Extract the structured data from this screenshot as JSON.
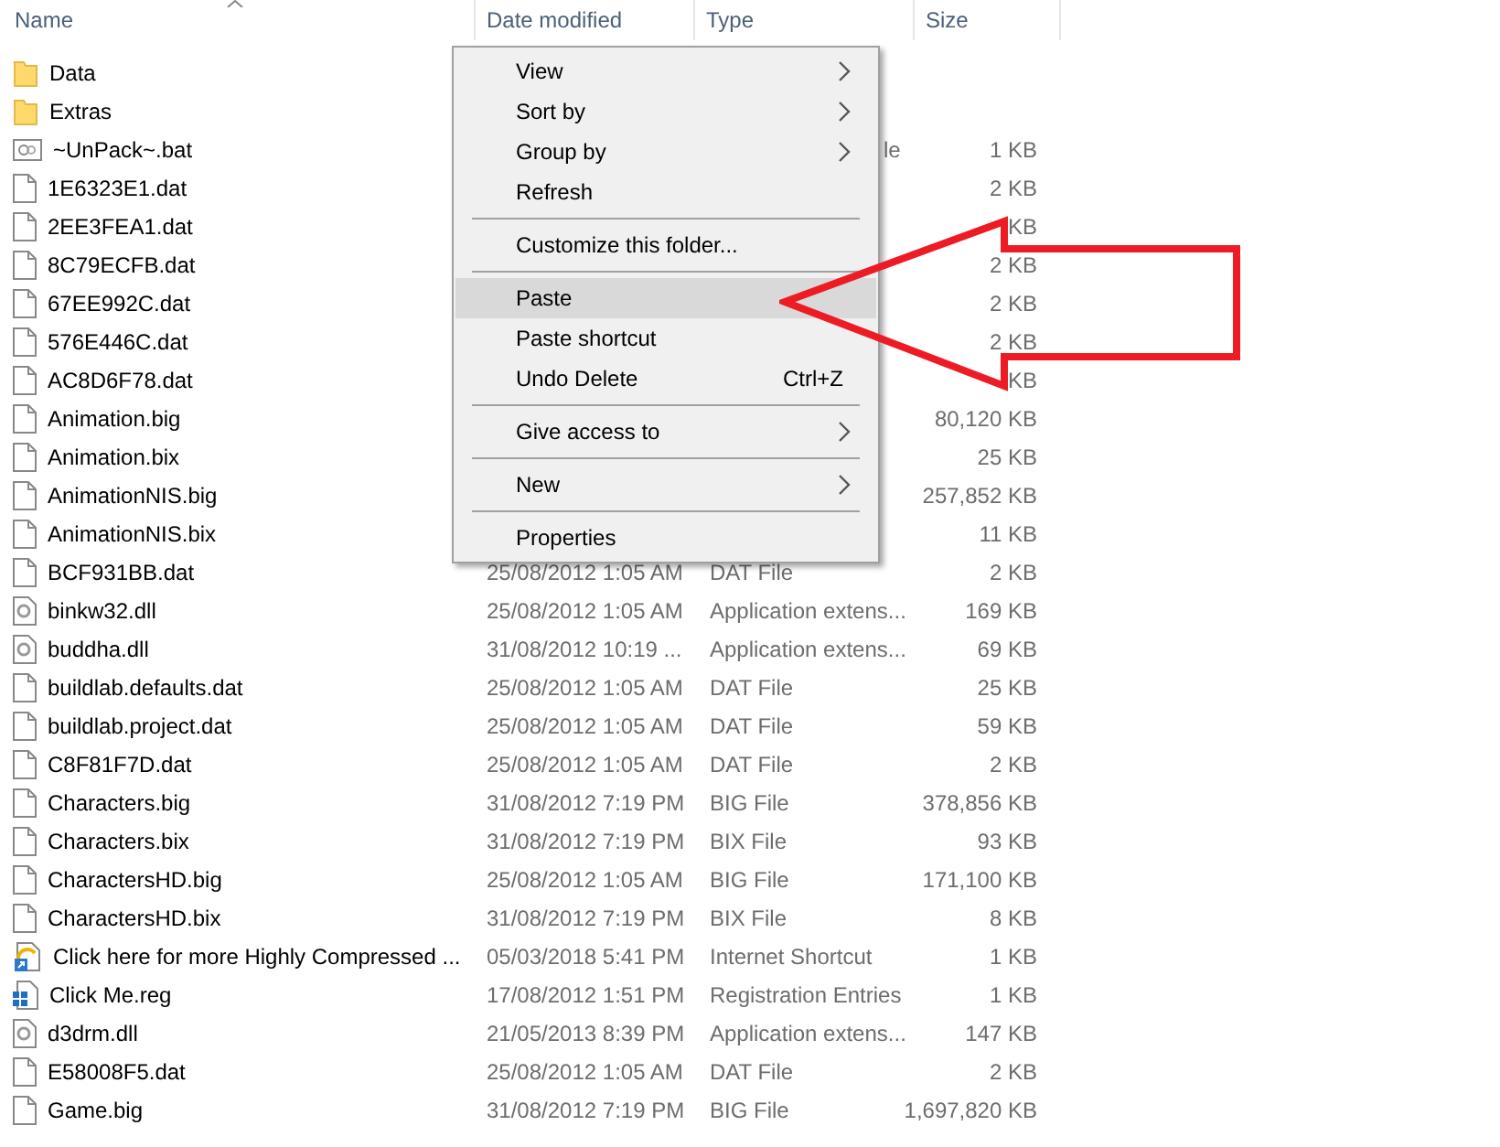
{
  "columns": [
    "Name",
    "Date modified",
    "Type",
    "Size"
  ],
  "rows": [
    {
      "kind": "folder",
      "name": "Data"
    },
    {
      "kind": "folder",
      "name": "Extras"
    },
    {
      "kind": "bat",
      "name": "~UnPack~.bat",
      "type": "le",
      "type_cut": true,
      "size": "1 KB"
    },
    {
      "kind": "file",
      "name": "1E6323E1.dat",
      "size": "2 KB"
    },
    {
      "kind": "file",
      "name": "2EE3FEA1.dat",
      "size": "KB"
    },
    {
      "kind": "file",
      "name": "8C79ECFB.dat",
      "size": "2 KB"
    },
    {
      "kind": "file",
      "name": "67EE992C.dat",
      "size": "2 KB"
    },
    {
      "kind": "file",
      "name": "576E446C.dat",
      "size": "2 KB"
    },
    {
      "kind": "file",
      "name": "AC8D6F78.dat",
      "size": "KB"
    },
    {
      "kind": "file",
      "name": "Animation.big",
      "size": "80,120 KB"
    },
    {
      "kind": "file",
      "name": "Animation.bix",
      "size": "25 KB"
    },
    {
      "kind": "file",
      "name": "AnimationNIS.big",
      "size": "257,852 KB"
    },
    {
      "kind": "file",
      "name": "AnimationNIS.bix",
      "size": "11 KB"
    },
    {
      "kind": "file",
      "name": "BCF931BB.dat",
      "date": "25/08/2012 1:05 AM",
      "type": "DAT File",
      "size": "2 KB"
    },
    {
      "kind": "dll",
      "name": "binkw32.dll",
      "date": "25/08/2012 1:05 AM",
      "type": "Application extens...",
      "size": "169 KB"
    },
    {
      "kind": "dll",
      "name": "buddha.dll",
      "date": "31/08/2012 10:19 ...",
      "type": "Application extens...",
      "size": "69 KB"
    },
    {
      "kind": "file",
      "name": "buildlab.defaults.dat",
      "date": "25/08/2012 1:05 AM",
      "type": "DAT File",
      "size": "25 KB"
    },
    {
      "kind": "file",
      "name": "buildlab.project.dat",
      "date": "25/08/2012 1:05 AM",
      "type": "DAT File",
      "size": "59 KB"
    },
    {
      "kind": "file",
      "name": "C8F81F7D.dat",
      "date": "25/08/2012 1:05 AM",
      "type": "DAT File",
      "size": "2 KB"
    },
    {
      "kind": "file",
      "name": "Characters.big",
      "date": "31/08/2012 7:19 PM",
      "type": "BIG File",
      "size": "378,856 KB"
    },
    {
      "kind": "file",
      "name": "Characters.bix",
      "date": "31/08/2012 7:19 PM",
      "type": "BIX File",
      "size": "93 KB"
    },
    {
      "kind": "file",
      "name": "CharactersHD.big",
      "date": "25/08/2012 1:05 AM",
      "type": "BIG File",
      "size": "171,100 KB"
    },
    {
      "kind": "file",
      "name": "CharactersHD.bix",
      "date": "31/08/2012 7:19 PM",
      "type": "BIX File",
      "size": "8 KB"
    },
    {
      "kind": "url",
      "name": "Click here for more Highly Compressed ...",
      "date": "05/03/2018 5:41 PM",
      "type": "Internet Shortcut",
      "size": "1 KB"
    },
    {
      "kind": "reg",
      "name": "Click Me.reg",
      "date": "17/08/2012 1:51 PM",
      "type": "Registration Entries",
      "size": "1 KB"
    },
    {
      "kind": "dll",
      "name": "d3drm.dll",
      "date": "21/05/2013 8:39 PM",
      "type": "Application extens...",
      "size": "147 KB"
    },
    {
      "kind": "file",
      "name": "E58008F5.dat",
      "date": "25/08/2012 1:05 AM",
      "type": "DAT File",
      "size": "2 KB"
    },
    {
      "kind": "file",
      "name": "Game.big",
      "date": "31/08/2012 7:19 PM",
      "type": "BIG File",
      "size": "1,697,820 KB"
    }
  ],
  "context_menu": [
    {
      "kind": "item",
      "label": "View",
      "submenu": true,
      "selected": false
    },
    {
      "kind": "item",
      "label": "Sort by",
      "submenu": true,
      "selected": false
    },
    {
      "kind": "item",
      "label": "Group by",
      "submenu": true,
      "selected": false
    },
    {
      "kind": "item",
      "label": "Refresh",
      "submenu": false,
      "selected": false
    },
    {
      "kind": "separator"
    },
    {
      "kind": "item",
      "label": "Customize this folder...",
      "submenu": false,
      "selected": false
    },
    {
      "kind": "separator"
    },
    {
      "kind": "item",
      "label": "Paste",
      "submenu": false,
      "selected": true
    },
    {
      "kind": "item",
      "label": "Paste shortcut",
      "submenu": false,
      "selected": false
    },
    {
      "kind": "item",
      "label": "Undo Delete",
      "shortcut": "Ctrl+Z",
      "submenu": false,
      "selected": false
    },
    {
      "kind": "separator"
    },
    {
      "kind": "item",
      "label": "Give access to",
      "submenu": true,
      "selected": false
    },
    {
      "kind": "separator"
    },
    {
      "kind": "item",
      "label": "New",
      "submenu": true,
      "selected": false
    },
    {
      "kind": "separator"
    },
    {
      "kind": "item",
      "label": "Properties",
      "submenu": false,
      "selected": false
    }
  ]
}
